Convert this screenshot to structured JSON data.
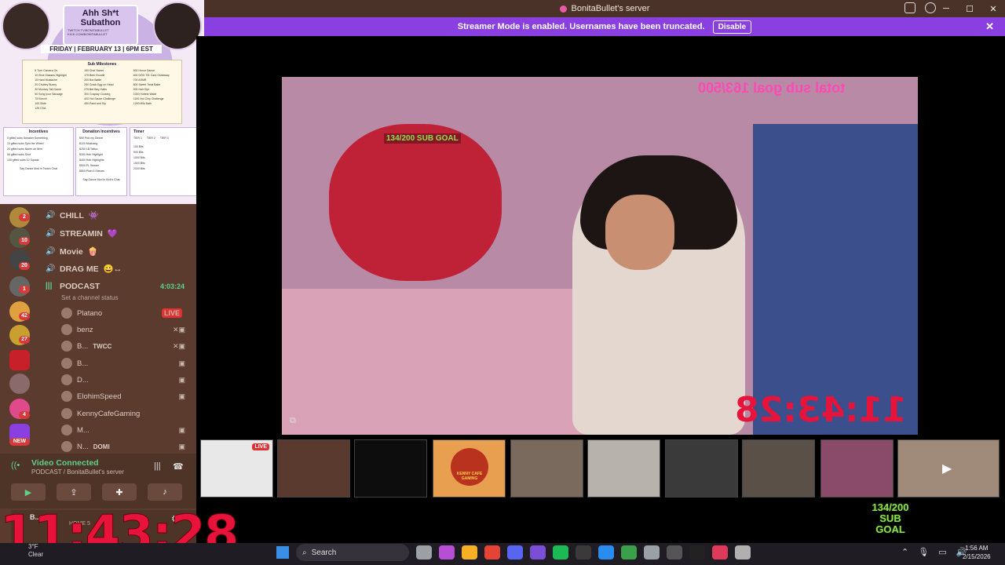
{
  "window": {
    "title": "BonitaBullet's server"
  },
  "banner": {
    "text": "Streamer Mode is enabled. Usernames have been truncated.",
    "button": "Disable"
  },
  "poster": {
    "title": "Ahh Sh*t Subathon",
    "links": [
      "TWITCH.TV/BONITABULLET",
      "KICK.COM/BONITABULLET"
    ],
    "date": "FRIDAY | FEBRUARY 13 | 6PM EST",
    "milestones_title": "Sub Milestones",
    "milestones": [
      [
        "5 Turn Camera On",
        "10 Shot Glasses Highlight",
        "15 Hard Mustache",
        "20 Chubby Bunny",
        "30 Monkey Tail Game",
        "50 Song your Sausage",
        "75 Kimchi",
        "100 Slide",
        "125 CSA"
      ],
      [
        "150 Chef Sweet",
        "175 Beer Doodle",
        "200 Bot Battle",
        "250 Crack Egg on Head",
        "275 Bet Bay Hulks",
        "300 Cosplay Cooking",
        "400 Hot Sauce Challenge",
        "450 Paint and Sip"
      ],
      [
        "500 Honor Dance",
        "600 DOG TIK Card Giveaway",
        "700 ASMR",
        "800 Sweet Treat Bake",
        "900 Hair Dye",
        "1000 Hottest Waist",
        "1100 Hot Chip Challenge",
        "1200 Milk Bath"
      ]
    ],
    "incentives": {
      "title": "Incentives",
      "rows": [
        "5 gifted subs Sneaker Something",
        "10 gifted subs Spin the Wheel",
        "20 gifted subs Name an Item",
        "50 gifted subs Shot",
        "100 gifted subs 10 Squats"
      ],
      "foot": "Say Dance Mod in Twitch Chat"
    },
    "donation": {
      "title": "Donation Incentives",
      "rows": [
        "$50 Pick my Dinner",
        "$100 Mukbang",
        "$250 LB Tattoo",
        "$300 Hair Highlight",
        "$400 Hair Highlights",
        "$500 PL Stream",
        "$800 Plain 5 Stream"
      ],
      "foot": "Say Dance Mod in Kick's Chat"
    },
    "timer": {
      "title": "Timer",
      "tiers": [
        "TIER 1",
        "TIER 2",
        "TIER 3"
      ],
      "rows": [
        "100 Bits",
        "500 Bits",
        "1000 Bits",
        "1500 Bits",
        "2000 Bits"
      ]
    }
  },
  "sidebar": {
    "channels": [
      {
        "name": "CHILL",
        "emoji": "👾"
      },
      {
        "name": "STREAMIN",
        "emoji": "💜"
      },
      {
        "name": "Movie",
        "emoji": "🍿"
      },
      {
        "name": "DRAG ME",
        "emoji": "😀↔"
      }
    ],
    "active_channel": {
      "name": "PODCAST",
      "time": "4:03:24",
      "status": "Set a channel status"
    },
    "users": [
      {
        "name": "Platano",
        "tag": "LIVE"
      },
      {
        "name": "benz",
        "tag": ""
      },
      {
        "name": "B...",
        "tag": "TWCC"
      },
      {
        "name": "B...",
        "tag": ""
      },
      {
        "name": "D...",
        "tag": ""
      },
      {
        "name": "ElohimSpeed",
        "tag": ""
      },
      {
        "name": "KennyCafeGaming",
        "tag": ""
      },
      {
        "name": "M...",
        "tag": ""
      },
      {
        "name": "N...",
        "tag": "DOMI"
      }
    ],
    "guild_badges": [
      "2",
      "10",
      "20",
      "1",
      "42",
      "27",
      "4",
      "NEW"
    ]
  },
  "voice": {
    "status": "Video Connected",
    "location": "PODCAST / BonitaBullet's server"
  },
  "user_panel": {
    "name": "B...",
    "status": "HOME 5"
  },
  "timer": {
    "big": "11:43:28",
    "video": "11:43:28"
  },
  "video": {
    "overlay_goal": "total sub goal 163/500",
    "overlay_goal2": "134/200 SUB GOAL"
  },
  "subgoal": {
    "count": "134/200",
    "label": "SUB GOAL"
  },
  "thumbs": {
    "live_label": "LIVE",
    "logo_text": "KENNY CAFE GAMING"
  },
  "taskbar": {
    "weather_temp": "3°F",
    "weather_text": "Clear",
    "search_placeholder": "Search",
    "time": "1:56 AM",
    "date": "2/15/2026",
    "app_colors": [
      "#9aa0a6",
      "#b64fd6",
      "#f6b026",
      "#e44336",
      "#5865f2",
      "#7a4fd6",
      "#1db954",
      "#3a3a3a",
      "#2a8cf0",
      "#3aa04a",
      "#9aa0a6",
      "#555555",
      "#222222",
      "#e03a5a",
      "#b0b0b0"
    ]
  }
}
